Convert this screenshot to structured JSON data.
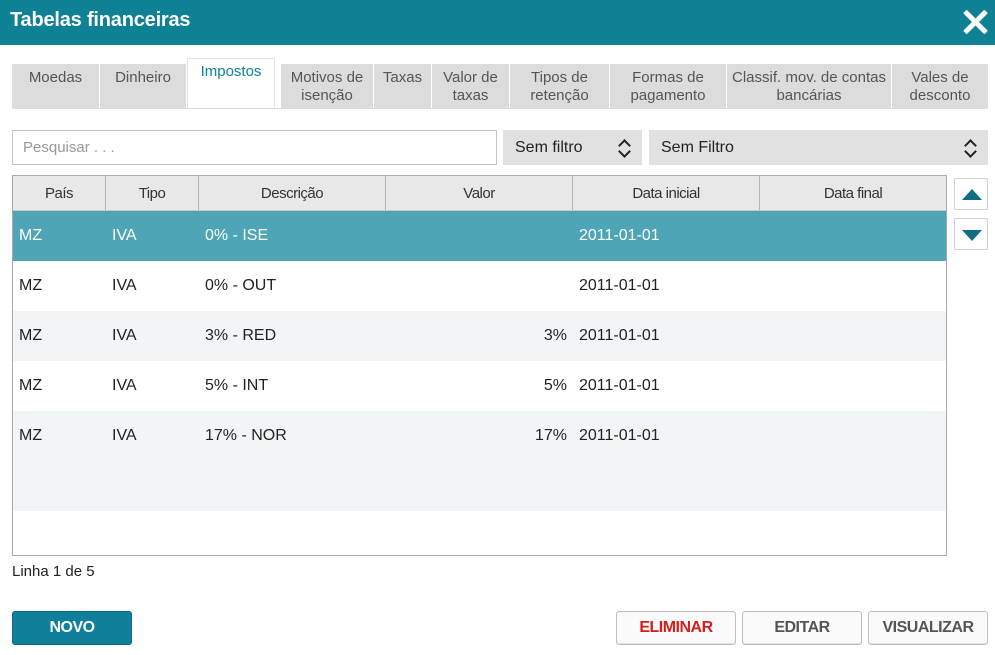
{
  "window": {
    "title": "Tabelas financeiras"
  },
  "tabs": [
    {
      "label": "Moedas"
    },
    {
      "label": "Dinheiro"
    },
    {
      "label": "Impostos",
      "active": true
    },
    {
      "label": "Motivos de isenção"
    },
    {
      "label": "Taxas"
    },
    {
      "label": "Valor de taxas"
    },
    {
      "label": "Tipos de retenção"
    },
    {
      "label": "Formas de pagamento"
    },
    {
      "label": "Classif. mov. de contas bancárias"
    },
    {
      "label": "Vales de desconto"
    }
  ],
  "filters": {
    "search_placeholder": "Pesquisar . . .",
    "filter1": "Sem filtro",
    "filter2": "Sem Filtro"
  },
  "table": {
    "columns": [
      "País",
      "Tipo",
      "Descrição",
      "Valor",
      "Data inicial",
      "Data final"
    ],
    "rows": [
      {
        "pais": "MZ",
        "tipo": "IVA",
        "descricao": "0% - ISE",
        "valor": "",
        "data_inicial": "2011-01-01",
        "data_final": "",
        "selected": true
      },
      {
        "pais": "MZ",
        "tipo": "IVA",
        "descricao": "0% - OUT",
        "valor": "",
        "data_inicial": "2011-01-01",
        "data_final": ""
      },
      {
        "pais": "MZ",
        "tipo": "IVA",
        "descricao": "3% - RED",
        "valor": "3%",
        "data_inicial": "2011-01-01",
        "data_final": ""
      },
      {
        "pais": "MZ",
        "tipo": "IVA",
        "descricao": "5% - INT",
        "valor": "5%",
        "data_inicial": "2011-01-01",
        "data_final": ""
      },
      {
        "pais": "MZ",
        "tipo": "IVA",
        "descricao": "17% - NOR",
        "valor": "17%",
        "data_inicial": "2011-01-01",
        "data_final": ""
      }
    ]
  },
  "status": {
    "text": "Linha 1 de 5"
  },
  "buttons": {
    "new": "NOVO",
    "delete": "ELIMINAR",
    "edit": "EDITAR",
    "view": "VISUALIZAR"
  },
  "colors": {
    "titlebar": "#0f8194",
    "selected_row": "#4ea5b6",
    "primary_button": "#10809a",
    "danger_text": "#d81d1d"
  }
}
